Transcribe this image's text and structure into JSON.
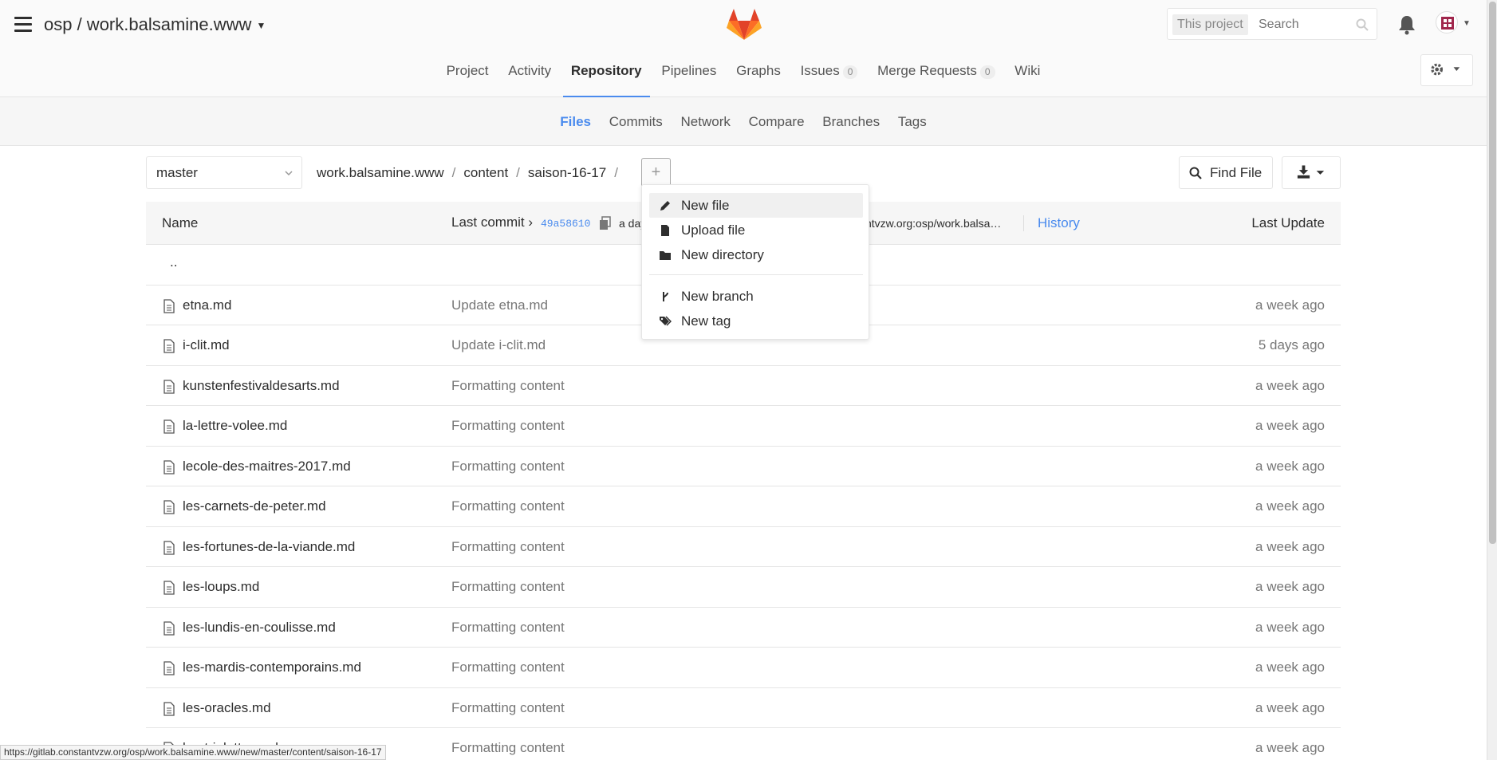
{
  "header": {
    "project_title": "osp / work.balsamine.www",
    "search_scope": "This project",
    "search_placeholder": "Search"
  },
  "main_nav": [
    {
      "label": "Project",
      "active": false
    },
    {
      "label": "Activity",
      "active": false
    },
    {
      "label": "Repository",
      "active": true
    },
    {
      "label": "Pipelines",
      "active": false
    },
    {
      "label": "Graphs",
      "active": false
    },
    {
      "label": "Issues",
      "active": false,
      "count": "0"
    },
    {
      "label": "Merge Requests",
      "active": false,
      "count": "0"
    },
    {
      "label": "Wiki",
      "active": false
    }
  ],
  "sub_nav": [
    {
      "label": "Files",
      "active": true
    },
    {
      "label": "Commits",
      "active": false
    },
    {
      "label": "Network",
      "active": false
    },
    {
      "label": "Compare",
      "active": false
    },
    {
      "label": "Branches",
      "active": false
    },
    {
      "label": "Tags",
      "active": false
    }
  ],
  "toolbar": {
    "branch": "master",
    "breadcrumb": [
      "work.balsamine.www",
      "content",
      "saison-16-17"
    ],
    "plus_label": "+",
    "find_file_label": "Find File"
  },
  "table": {
    "headers": {
      "name": "Name",
      "last_commit": "Last commit",
      "sha": "49a58610",
      "when_partial": "a day",
      "author_partial": "ntvzw.org:osp/work.balsa…",
      "history": "History",
      "last_update": "Last Update"
    },
    "up_dir": "..",
    "rows": [
      {
        "name": "etna.md",
        "message": "Update etna.md",
        "date": "a week ago"
      },
      {
        "name": "i-clit.md",
        "message": "Update i-clit.md",
        "date": "5 days ago"
      },
      {
        "name": "kunstenfestivaldesarts.md",
        "message": "Formatting content",
        "date": "a week ago"
      },
      {
        "name": "la-lettre-volee.md",
        "message": "Formatting content",
        "date": "a week ago"
      },
      {
        "name": "lecole-des-maitres-2017.md",
        "message": "Formatting content",
        "date": "a week ago"
      },
      {
        "name": "les-carnets-de-peter.md",
        "message": "Formatting content",
        "date": "a week ago"
      },
      {
        "name": "les-fortunes-de-la-viande.md",
        "message": "Formatting content",
        "date": "a week ago"
      },
      {
        "name": "les-loups.md",
        "message": "Formatting content",
        "date": "a week ago"
      },
      {
        "name": "les-lundis-en-coulisse.md",
        "message": "Formatting content",
        "date": "a week ago"
      },
      {
        "name": "les-mardis-contemporains.md",
        "message": "Formatting content",
        "date": "a week ago"
      },
      {
        "name": "les-oracles.md",
        "message": "Formatting content",
        "date": "a week ago"
      },
      {
        "name": "les-triplettes.md",
        "message": "Formatting content",
        "date": "a week ago"
      }
    ]
  },
  "dropdown": {
    "items": [
      {
        "label": "New file",
        "icon": "pencil-icon"
      },
      {
        "label": "Upload file",
        "icon": "file-icon"
      },
      {
        "label": "New directory",
        "icon": "folder-icon"
      },
      {
        "label": "New branch",
        "icon": "branch-icon"
      },
      {
        "label": "New tag",
        "icon": "tags-icon"
      }
    ]
  },
  "status_bar": "https://gitlab.constantvzw.org/osp/work.balsamine.www/new/master/content/saison-16-17",
  "colors": {
    "accent": "#4a8bee",
    "text": "#2e2e2e",
    "muted": "#777777",
    "header_bg": "#fafafa",
    "subnav_bg": "#f6f6f6"
  }
}
